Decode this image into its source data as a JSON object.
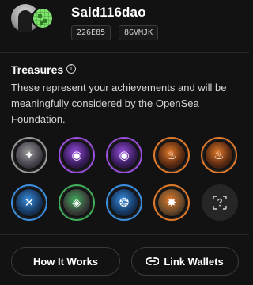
{
  "profile": {
    "username": "Said116dao",
    "chips": [
      "226E85",
      "8GVMJK"
    ]
  },
  "treasures": {
    "title": "Treasures",
    "info_icon": "info-icon",
    "description": "These represent your achievements and will be meaningfully considered by the OpenSea Foundation.",
    "badges": [
      {
        "ring": "#9a9a9a",
        "inner": "#4a4650",
        "glyph": "✦",
        "icon": "gray-gem-badge-icon"
      },
      {
        "ring": "#9b4fe0",
        "inner": "#3a1d5e",
        "glyph": "◉",
        "icon": "purple-orb-badge-icon"
      },
      {
        "ring": "#9b4fe0",
        "inner": "#3a1d5e",
        "glyph": "◉",
        "icon": "purple-orb-badge-icon"
      },
      {
        "ring": "#e07a2a",
        "inner": "#5e2c12",
        "glyph": "♨",
        "icon": "orange-flame-badge-icon"
      },
      {
        "ring": "#e07a2a",
        "inner": "#5e2c12",
        "glyph": "♨",
        "icon": "orange-flame-badge-icon"
      },
      {
        "ring": "#3a8fe0",
        "inner": "#173a63",
        "glyph": "✕",
        "icon": "blue-cross-badge-icon"
      },
      {
        "ring": "#3fae5a",
        "inner": "#3a3f3a",
        "glyph": "◈",
        "icon": "green-gem-badge-icon"
      },
      {
        "ring": "#3a8fe0",
        "inner": "#163a66",
        "glyph": "❂",
        "icon": "blue-flame-badge-icon"
      },
      {
        "ring": "#e07a2a",
        "inner": "#6a4a2a",
        "glyph": "✸",
        "icon": "orange-crystal-badge-icon"
      }
    ],
    "empty_badge_icon": "question-mark-scan-icon"
  },
  "actions": {
    "how_it_works": "How It Works",
    "link_wallets": "Link Wallets",
    "link_icon": "link-icon"
  },
  "colors": {
    "background": "#121212",
    "border": "#262626",
    "text_secondary": "#d6d6d6"
  }
}
